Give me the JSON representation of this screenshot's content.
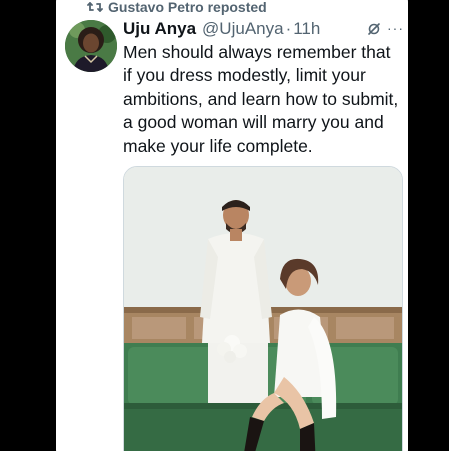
{
  "repost_banner": {
    "icon": "repost-icon",
    "text": "Gustavo Petro reposted"
  },
  "tweet": {
    "author_name": "Uju Anya",
    "handle": "@UjuAnya",
    "separator": "·",
    "time": "11h",
    "more_label": "···",
    "text": "Men should always remember that if you dress modestly, limit your ambitions, and learn how to submit, a good woman will marry you and make your life complete."
  },
  "media": {
    "icon": "photo"
  },
  "colors": {
    "background": "#000000",
    "card": "#ffffff",
    "text_primary": "#0f1419",
    "text_secondary": "#536471",
    "sofa_green": "#3f7d50",
    "photo_wall": "#e8ece7"
  }
}
